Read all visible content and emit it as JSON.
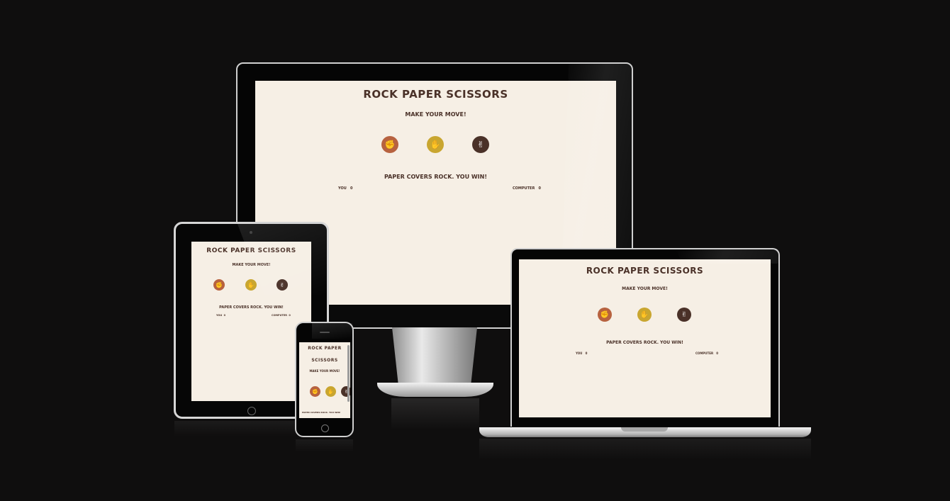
{
  "game": {
    "title": "ROCK PAPER SCISSORS",
    "title_line1": "ROCK PAPER",
    "title_line2": "SCISSORS",
    "subtitle": "MAKE YOUR MOVE!",
    "result": "PAPER COVERS ROCK. YOU WIN!",
    "player_label": "YOU",
    "player_score": "0",
    "computer_label": "COMPUTER",
    "computer_score": "0"
  },
  "choices": [
    {
      "name": "rock",
      "icon": "fist-icon",
      "glyph": "✊",
      "color": "#b7623f"
    },
    {
      "name": "paper",
      "icon": "open-hand-icon",
      "glyph": "✋",
      "color": "#c9a630"
    },
    {
      "name": "scissors",
      "icon": "peace-hand-icon",
      "glyph": "✌",
      "color": "#4a3128"
    }
  ],
  "colors": {
    "page_background": "#0f0e0e",
    "screen_background": "#f6efe5",
    "text": "#4a3128"
  }
}
